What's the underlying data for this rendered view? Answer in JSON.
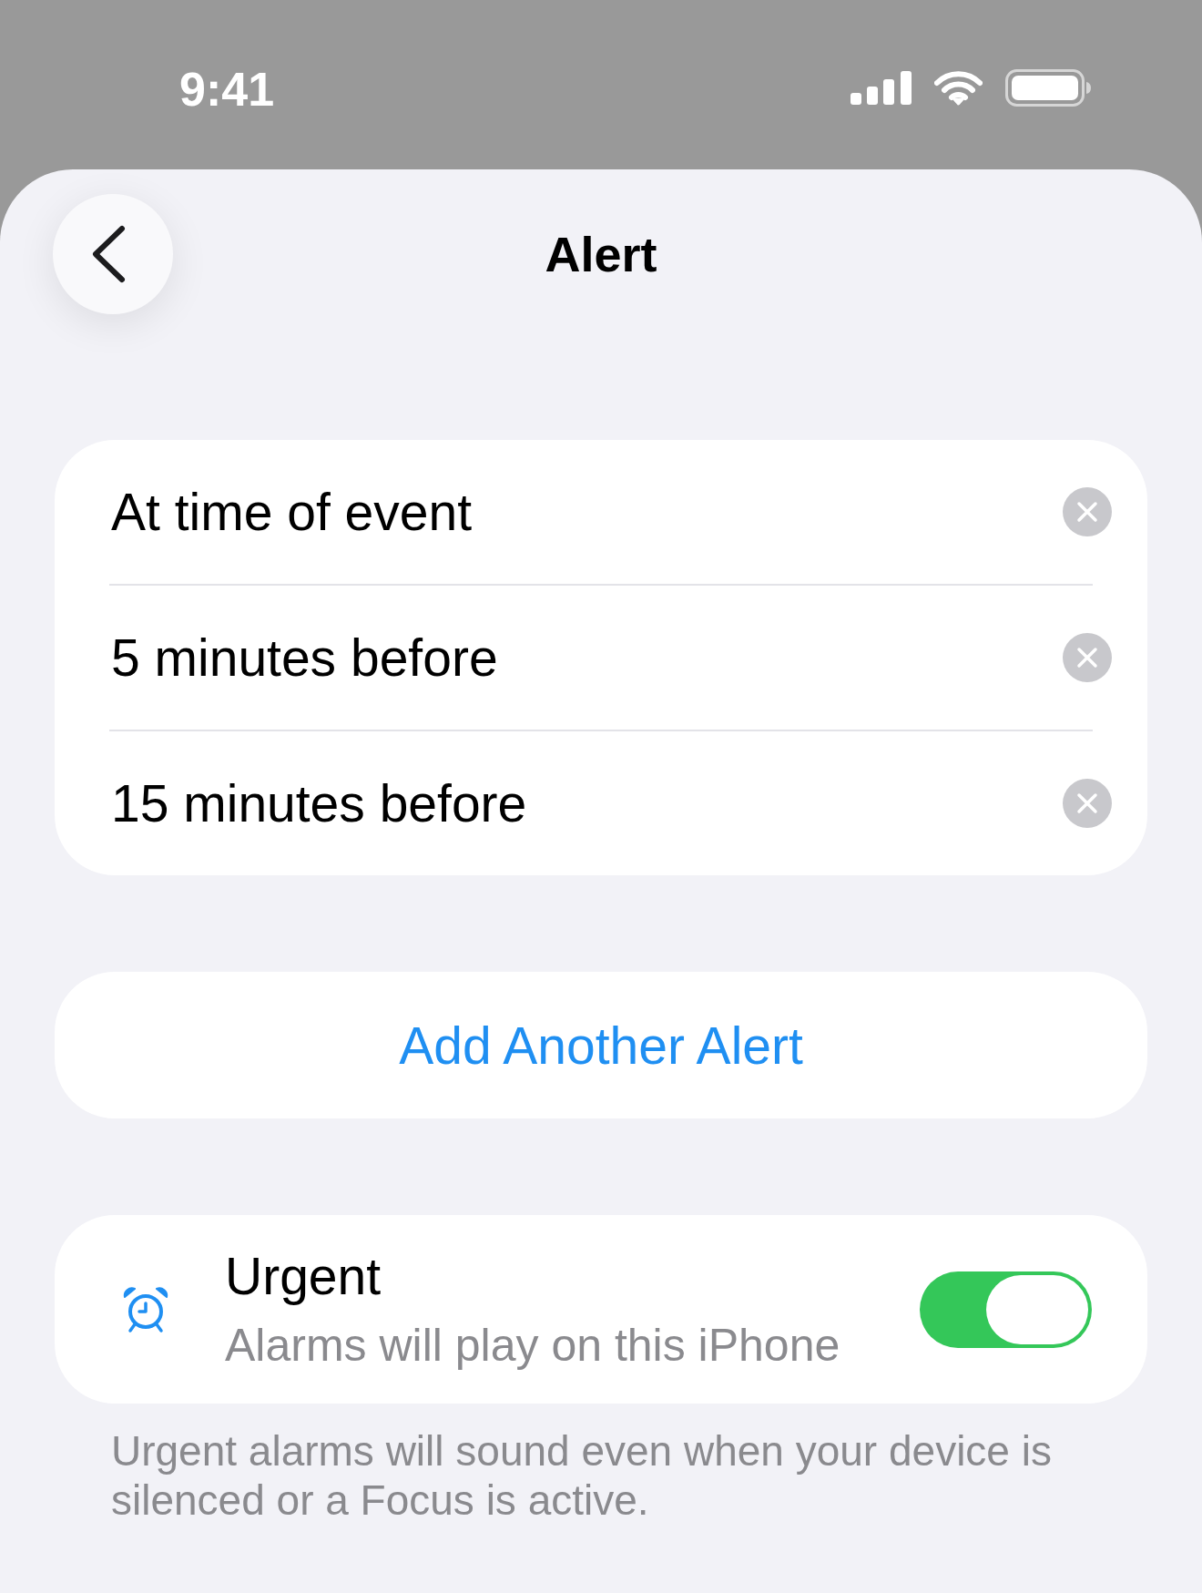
{
  "status_bar": {
    "time": "9:41"
  },
  "header": {
    "title": "Alert"
  },
  "alerts": [
    {
      "label": "At time of event"
    },
    {
      "label": "5 minutes before"
    },
    {
      "label": "15 minutes before"
    }
  ],
  "add_button": {
    "label": "Add Another Alert"
  },
  "urgent": {
    "title": "Urgent",
    "subtitle": "Alarms will play on this iPhone",
    "on": true
  },
  "footer": "Urgent alarms will sound even when your device is silenced or a Focus is active."
}
